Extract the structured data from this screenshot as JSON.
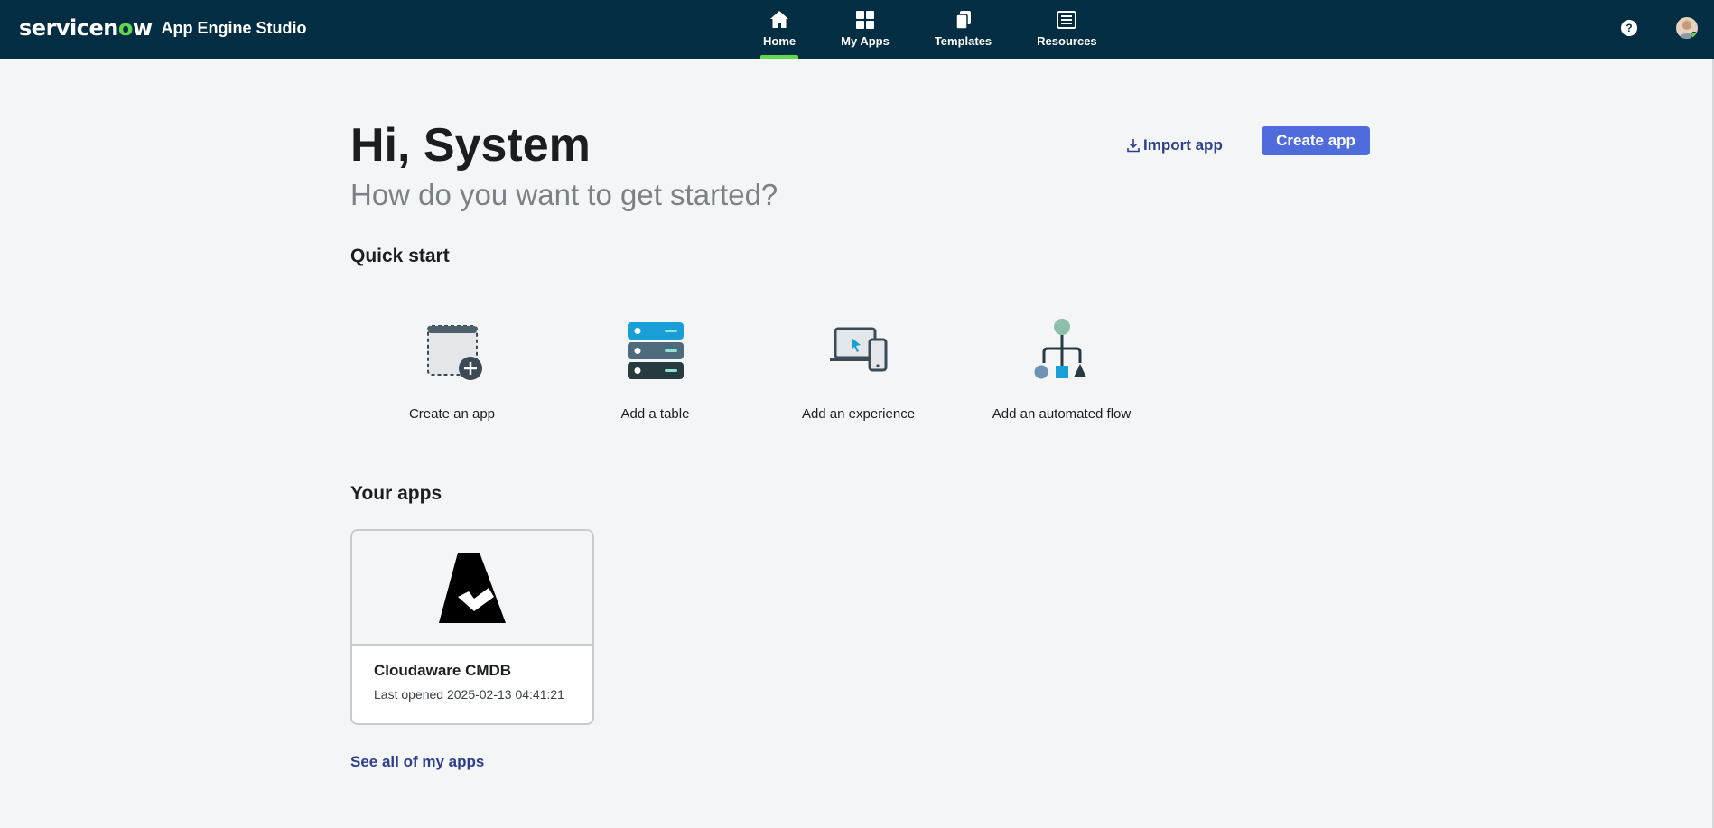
{
  "header": {
    "brand_logo": "servicenow",
    "app_title": "App Engine Studio",
    "nav": [
      {
        "label": "Home",
        "icon": "home-icon",
        "active": true
      },
      {
        "label": "My Apps",
        "icon": "grid-icon",
        "active": false
      },
      {
        "label": "Templates",
        "icon": "templates-icon",
        "active": false
      },
      {
        "label": "Resources",
        "icon": "resources-icon",
        "active": false
      }
    ],
    "help_symbol": "?",
    "accent_color": "#62d84e",
    "bar_color": "#032d42"
  },
  "main": {
    "greeting": "Hi, System",
    "subgreeting": "How do you want to get started?",
    "import_label": "Import app",
    "create_label": "Create app",
    "quick_start_title": "Quick start",
    "quick_start": [
      {
        "label": "Create an app",
        "icon": "create-app-icon"
      },
      {
        "label": "Add a table",
        "icon": "table-icon"
      },
      {
        "label": "Add an experience",
        "icon": "experience-icon"
      },
      {
        "label": "Add an automated flow",
        "icon": "flow-icon"
      }
    ],
    "your_apps_title": "Your apps",
    "apps": [
      {
        "name": "Cloudaware CMDB",
        "last_opened": "Last opened 2025-02-13 04:41:21",
        "icon": "cloudaware-logo"
      }
    ],
    "see_all_label": "See all of my apps"
  }
}
